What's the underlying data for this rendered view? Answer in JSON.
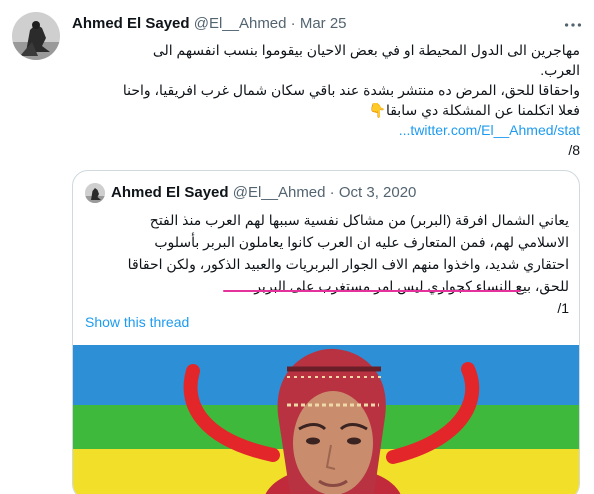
{
  "tweet": {
    "author_name": "Ahmed El Sayed",
    "handle": "@El__Ahmed",
    "separator": "·",
    "date": "Mar 25",
    "lines": [
      "مهاجرين الى الدول المحيطة او في بعض الاحيان بيقوموا بنسب انفسهم الى",
      "العرب.",
      "واحقاقا للحق، المرض ده منتشر بشدة عند باقي سكان شمال غرب افريقيا، واحنا",
      "فعلا اتكلمنا عن المشكلة دي سابقا👇"
    ],
    "link": "twitter.com/El__Ahmed/stat...",
    "counter": "8/"
  },
  "quoted": {
    "author_name": "Ahmed El Sayed",
    "handle": "@El__Ahmed",
    "separator": "·",
    "date": "Oct 3, 2020",
    "lines": [
      "يعاني الشمال افرقة (البربر) من مشاكل نفسية سببها لهم العرب منذ الفتح",
      "الاسلامي لهم، فمن المتعارف عليه ان العرب كانوا يعاملون البربر بأسلوب",
      "احتقاري شديد، واخذوا منهم الاف الجوار البربريات والعبيد الذكور، ولكن احقاقا",
      "للحق، بيع النساء كجواري ليس امر مستغرب على البربر",
      "1/"
    ],
    "show_thread": "Show this thread"
  },
  "colors": {
    "link": "#1d9bf0",
    "muted": "#536471",
    "annotation_underline": "#e5319b",
    "flag_blue": "#2d8fd5",
    "flag_green": "#3fb93b",
    "flag_yellow": "#f2df2a",
    "flag_red": "#e3262a"
  },
  "icons": {
    "more": "more-horizontal-icon"
  }
}
